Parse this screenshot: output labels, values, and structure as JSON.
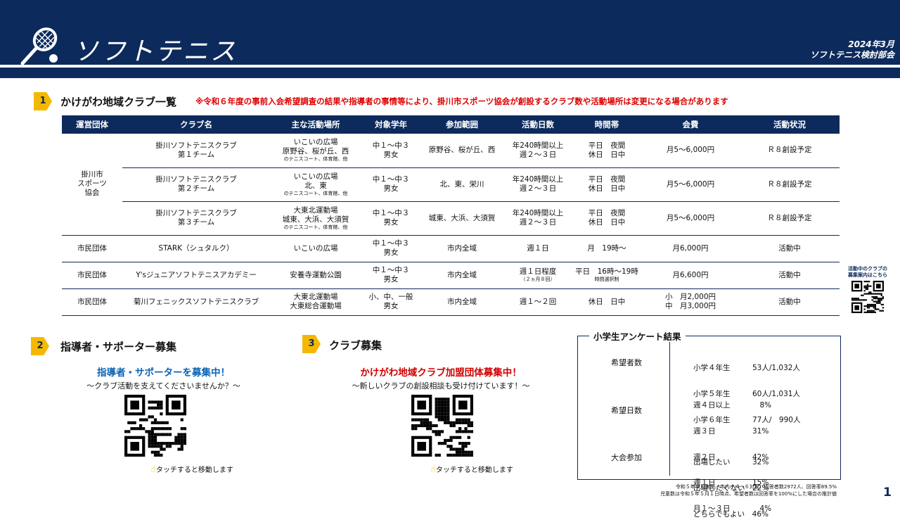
{
  "header": {
    "title": "ソフトテニス",
    "date": "2024年3月",
    "org": "ソフトテニス検討部会"
  },
  "section1": {
    "num": "1",
    "title": "かけがわ地域クラブ一覧",
    "note": "※令和６年度の事前入会希望調査の結果や指導者の事情等により、掛川市スポーツ協会が創設するクラブ数や活動場所は変更になる場合があります"
  },
  "table": {
    "headers": [
      "運営団体",
      "クラブ名",
      "主な活動場所",
      "対象学年",
      "参加範囲",
      "活動日数",
      "時間帯",
      "会費",
      "活動状況"
    ],
    "group": [
      "掛川市",
      "スポーツ",
      "協会"
    ],
    "rows": [
      {
        "club": [
          "掛川ソフトテニスクラブ",
          "第１チーム"
        ],
        "place": [
          "いこいの広場",
          "原野谷、桜が丘、西"
        ],
        "place_note": "のテニスコート、体育館、他",
        "grade": [
          "中１～中３",
          "男女"
        ],
        "area": "原野谷、桜が丘、西",
        "days": [
          "年240時間以上",
          "週２～３日"
        ],
        "time": [
          "平日　夜間",
          "休日　日中"
        ],
        "fee": "月5～6,000円",
        "status": "Ｒ８創設予定"
      },
      {
        "club": [
          "掛川ソフトテニスクラブ",
          "第２チーム"
        ],
        "place": [
          "いこいの広場",
          "北、東"
        ],
        "place_note": "のテニスコート、体育館、他",
        "grade": [
          "中１～中３",
          "男女"
        ],
        "area": "北、東、栄川",
        "days": [
          "年240時間以上",
          "週２～３日"
        ],
        "time": [
          "平日　夜間",
          "休日　日中"
        ],
        "fee": "月5～6,000円",
        "status": "Ｒ８創設予定"
      },
      {
        "club": [
          "掛川ソフトテニスクラブ",
          "第３チーム"
        ],
        "place": [
          "大東北運動場",
          "城東、大浜、大須賀"
        ],
        "place_note": "のテニスコート、体育館、他",
        "grade": [
          "中１～中３",
          "男女"
        ],
        "area": "城東、大浜、大須賀",
        "days": [
          "年240時間以上",
          "週２～３日"
        ],
        "time": [
          "平日　夜間",
          "休日　日中"
        ],
        "fee": "月5～6,000円",
        "status": "Ｒ８創設予定"
      },
      {
        "org": "市民団体",
        "club": [
          "STARK（シュタルク）"
        ],
        "place": [
          "いこいの広場"
        ],
        "grade": [
          "中１～中３",
          "男女"
        ],
        "area": "市内全域",
        "days": [
          "週１日"
        ],
        "time": [
          "月　19時～"
        ],
        "fee": "月6,000円",
        "status": "活動中"
      },
      {
        "org": "市民団体",
        "club": [
          "Y'sジュニアソフトテニスアカデミー"
        ],
        "place": [
          "安養寺運動公園"
        ],
        "grade": [
          "中１～中３",
          "男女"
        ],
        "area": "市内全域",
        "days": [
          "週１日程度"
        ],
        "days_note": "（２ヵ月８回）",
        "time": [
          "平日　16時～19時"
        ],
        "time_note": "時間選択制",
        "fee": "月6,600円",
        "status": "活動中"
      },
      {
        "org": "市民団体",
        "club": [
          "菊川フェニックスソフトテニスクラブ"
        ],
        "place": [
          "大東北運動場",
          "大東総合運動場"
        ],
        "grade": [
          "小、中、一般",
          "男女"
        ],
        "area": "市内全域",
        "days": [
          "週１～２回"
        ],
        "time": [
          "休日　日中"
        ],
        "fee": [
          "小　月2,000円",
          "中　月3,000円"
        ],
        "status": "活動中"
      }
    ]
  },
  "side_qr": {
    "text1": "活動中のクラブの",
    "text2": "募集案内はこちら"
  },
  "section2": {
    "num": "2",
    "title": "指導者・サポーター募集",
    "headline": "指導者・サポーターを募集中！",
    "sub": "～クラブ活動を支えてくださいませんか？～",
    "touch": "タッチすると移動します",
    "color": "#0a64b4"
  },
  "section3": {
    "num": "3",
    "title": "クラブ募集",
    "headline": "かけがわ地域クラブ加盟団体募集中！",
    "sub": "～新しいクラブの創設相談も受け付けています！～",
    "touch": "タッチすると移動します",
    "color": "#d00000"
  },
  "survey": {
    "title": "小学生アンケート結果",
    "groups": [
      {
        "label": "希望者数",
        "rows": [
          "小学４年生　　　53人/1,032人",
          "小学５年生　　　60人/1,031人",
          "小学６年生　　　77人/　990人"
        ]
      },
      {
        "label": "希望日数",
        "rows": [
          "週４日以上　　　　8%",
          "週３日　　　　　31%",
          "週２日　　　　　42%",
          "週１日　　　　　15%",
          "月１～３日　　　　4%"
        ]
      },
      {
        "label": "大会参加",
        "rows": [
          "出場したい　　　32%",
          "出場したくない　22%",
          "どちらでもよい　46%"
        ]
      }
    ],
    "footnote1": "令和５年９月実施、市内小４～６対象、回答者数2972人、回答率89.5%",
    "footnote2": "児童数は令和５年５月１日時点、希望者数は回答率を100%にした場合の推計値"
  },
  "page": "1",
  "colors": {
    "navy": "#0d2a5c",
    "accent": "#f5b800",
    "red": "#d00000",
    "blue": "#0a64b4"
  }
}
